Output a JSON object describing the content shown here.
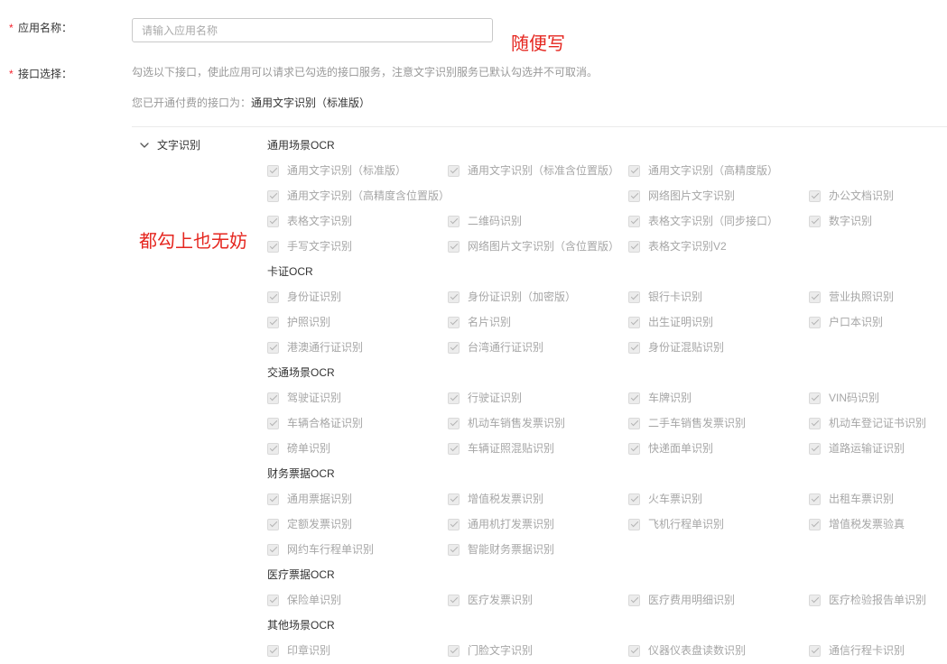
{
  "form": {
    "app_name": {
      "required_mark": "*",
      "label": "应用名称：",
      "value": "",
      "placeholder": "请输入应用名称"
    },
    "api_select": {
      "required_mark": "*",
      "label": "接口选择：",
      "description": "勾选以下接口，使此应用可以请求已勾选的接口服务，注意文字识别服务已默认勾选并不可取消。",
      "paid_prefix": "您已开通付费的接口为：",
      "paid_api": "通用文字识别（标准版）"
    }
  },
  "annotations": {
    "app_name_hint": "随便写",
    "api_select_hint": "都勾上也无妨"
  },
  "service": {
    "name": "文字识别",
    "expanded": true,
    "option_state": {
      "checked": true,
      "disabled": true
    },
    "groups": [
      {
        "title": "通用场景OCR",
        "options": [
          "通用文字识别（标准版）",
          "通用文字识别（标准含位置版）",
          "通用文字识别（高精度版）",
          "通用文字识别（高精度含位置版）",
          "网络图片文字识别",
          "办公文档识别",
          "表格文字识别",
          "二维码识别",
          "表格文字识别（同步接口）",
          "数字识别",
          "手写文字识别",
          "网络图片文字识别（含位置版）",
          "表格文字识别V2"
        ]
      },
      {
        "title": "卡证OCR",
        "options": [
          "身份证识别",
          "身份证识别（加密版）",
          "银行卡识别",
          "营业执照识别",
          "护照识别",
          "名片识别",
          "出生证明识别",
          "户口本识别",
          "港澳通行证识别",
          "台湾通行证识别",
          "身份证混贴识别"
        ]
      },
      {
        "title": "交通场景OCR",
        "options": [
          "驾驶证识别",
          "行驶证识别",
          "车牌识别",
          "VIN码识别",
          "车辆合格证识别",
          "机动车销售发票识别",
          "二手车销售发票识别",
          "机动车登记证书识别",
          "磅单识别",
          "车辆证照混贴识别",
          "快递面单识别",
          "道路运输证识别"
        ]
      },
      {
        "title": "财务票据OCR",
        "options": [
          "通用票据识别",
          "增值税发票识别",
          "火车票识别",
          "出租车票识别",
          "定额发票识别",
          "通用机打发票识别",
          "飞机行程单识别",
          "增值税发票验真",
          "网约车行程单识别",
          "智能财务票据识别"
        ]
      },
      {
        "title": "医疗票据OCR",
        "options": [
          "保险单识别",
          "医疗发票识别",
          "医疗费用明细识别",
          "医疗检验报告单识别"
        ]
      },
      {
        "title": "其他场景OCR",
        "options": [
          "印章识别",
          "门脸文字识别",
          "仪器仪表盘读数识别",
          "通信行程卡识别"
        ]
      }
    ]
  },
  "icons": {
    "service_toggle": "chevron-down",
    "option_check": "checkmark"
  },
  "colors": {
    "required": "#f5222d",
    "annotation": "#e5261f",
    "text": "#333333",
    "muted": "#999999",
    "option_text": "#a6a6a6",
    "box_bg": "#ececec",
    "check": "#b3b3b3"
  }
}
